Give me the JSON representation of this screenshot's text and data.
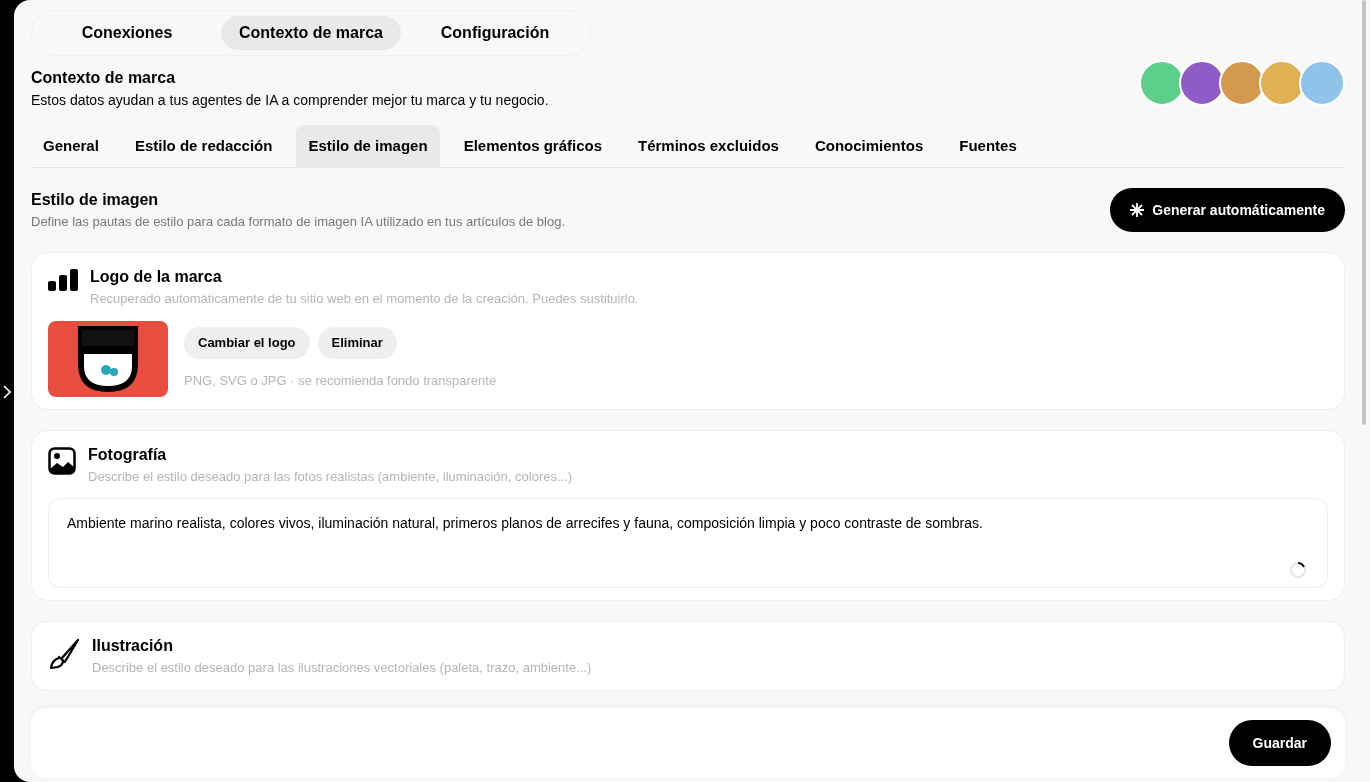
{
  "top_tabs": [
    {
      "label": "Conexiones",
      "selected": false
    },
    {
      "label": "Contexto de marca",
      "selected": true
    },
    {
      "label": "Configuración",
      "selected": false
    }
  ],
  "header": {
    "title": "Contexto de marca",
    "subtitle": "Estos datos ayudan a tus agentes de IA a comprender mejor tu marca y tu negocio.",
    "avatars": [
      {
        "color": "#5ccf8a"
      },
      {
        "color": "#8e5bc7"
      },
      {
        "color": "#d39a4f"
      },
      {
        "color": "#e0b154"
      },
      {
        "color": "#8fc3ea"
      }
    ]
  },
  "sub_tabs": [
    {
      "label": "General",
      "selected": false
    },
    {
      "label": "Estilo de redacción",
      "selected": false
    },
    {
      "label": "Estilo de imagen",
      "selected": true
    },
    {
      "label": "Elementos gráficos",
      "selected": false
    },
    {
      "label": "Términos excluidos",
      "selected": false
    },
    {
      "label": "Conocimientos",
      "selected": false
    },
    {
      "label": "Fuentes",
      "selected": false
    }
  ],
  "section": {
    "title": "Estilo de imagen",
    "subtitle": "Define las pautas de estilo para cada formato de imagen IA utilizado en tus artículos de blog.",
    "action": "Generar automáticamente"
  },
  "cards": [
    {
      "kind": "logo",
      "title": "Logo de la marca",
      "subtitle": "Recuperado automáticamente de tu sitio web en el momento de la creación. Puedes sustituirlo.",
      "buttons": [
        "Cambiar el logo",
        "Eliminar"
      ],
      "hint": "PNG, SVG o JPG · se recomienda fondo transparente"
    },
    {
      "kind": "photo",
      "title": "Fotografía",
      "subtitle": "Describe el estilo deseado para las fotos realistas (ambiente, iluminación, colores...)",
      "value": "Ambiente marino realista, colores vivos, iluminación natural, primeros planos de arrecifes y fauna, composición limpia y poco contraste de sombras.",
      "loading": true
    },
    {
      "kind": "illustration",
      "title": "Ilustración",
      "subtitle": "Describe el estilo deseado para las ilustraciones vectoriales (paleta, trazo, ambiente...)"
    }
  ],
  "footer": {
    "save": "Guardar"
  }
}
